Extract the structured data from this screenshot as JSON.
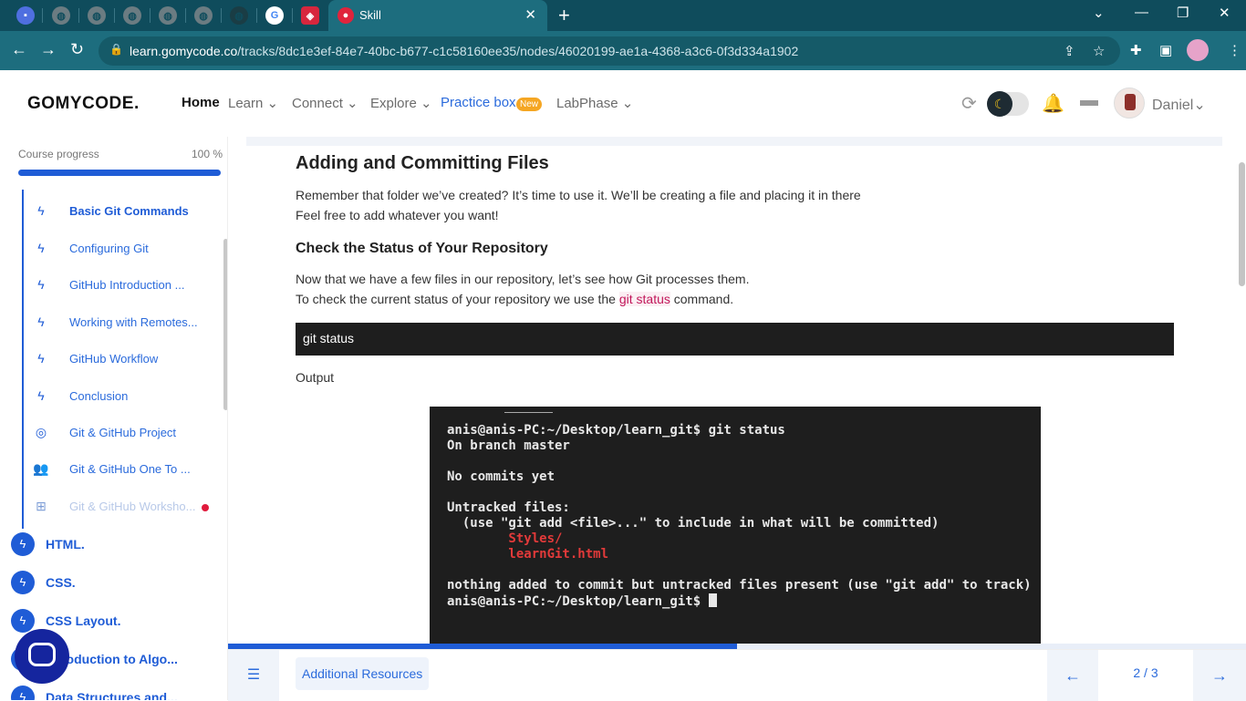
{
  "browser": {
    "tab_title": "Skill",
    "url_domain": "learn.gomycode.co",
    "url_path": "/tracks/8dc1e3ef-84e7-40bc-b677-c1c58160ee35/nodes/46020199-ae1a-4368-a3c6-0f3d334a1902"
  },
  "header": {
    "logo": "GOMYCODE.",
    "nav": {
      "home": "Home",
      "learn": "Learn",
      "connect": "Connect",
      "explore": "Explore",
      "practice": "Practice box",
      "practice_badge": "New",
      "labphase": "LabPhase"
    },
    "username": "Daniel"
  },
  "sidebar": {
    "progress_label": "Course progress",
    "progress_value": "100 %",
    "progress_fraction": 1.0,
    "items": [
      {
        "label": "Basic Git Commands",
        "icon": "bolt-icon"
      },
      {
        "label": "Configuring Git",
        "icon": "bolt-icon"
      },
      {
        "label": "GitHub Introduction ...",
        "icon": "bolt-icon"
      },
      {
        "label": "Working with Remotes...",
        "icon": "bolt-icon"
      },
      {
        "label": "GitHub Workflow",
        "icon": "bolt-icon"
      },
      {
        "label": "Conclusion",
        "icon": "bolt-icon"
      },
      {
        "label": "Git & GitHub Project",
        "icon": "target-icon"
      },
      {
        "label": "Git & GitHub One To ...",
        "icon": "people-icon"
      },
      {
        "label": "Git & GitHub Worksho...",
        "icon": "workshop-icon"
      }
    ],
    "sections": [
      {
        "label": "HTML."
      },
      {
        "label": "CSS."
      },
      {
        "label": "CSS Layout."
      },
      {
        "label": "Introduction to Algo..."
      },
      {
        "label": "Data Structures and..."
      }
    ]
  },
  "content": {
    "title": "Adding and Committing Files",
    "para1_line1": "Remember that folder we’ve created? It’s time to use it. We’ll be creating a file and placing it in there",
    "para1_line2": "Feel free to add whatever you want!",
    "subtitle": "Check the Status of Your Repository",
    "para2_line1": "Now that we have a few files in our repository, let’s see how Git processes them.",
    "para2_line2_pre": "To check the current status of your repository we use the ",
    "para2_code": "git status",
    "para2_line2_post": " command.",
    "code": "git status",
    "output_label": "Output",
    "terminal": {
      "l1": "anis@anis-PC:~/Desktop/learn_git$ git status",
      "l2": "On branch master",
      "l3": "No commits yet",
      "l4": "Untracked files:",
      "l5": "  (use \"git add <file>...\" to include in what will be committed)",
      "l6": "        Styles/",
      "l7": "        learnGit.html",
      "l8": "nothing added to commit but untracked files present (use \"git add\" to track)",
      "l9": "anis@anis-PC:~/Desktop/learn_git$ "
    }
  },
  "footer": {
    "resources_label": "Additional Resources",
    "page_indicator": "2 / 3",
    "reading_progress": 0.5
  }
}
